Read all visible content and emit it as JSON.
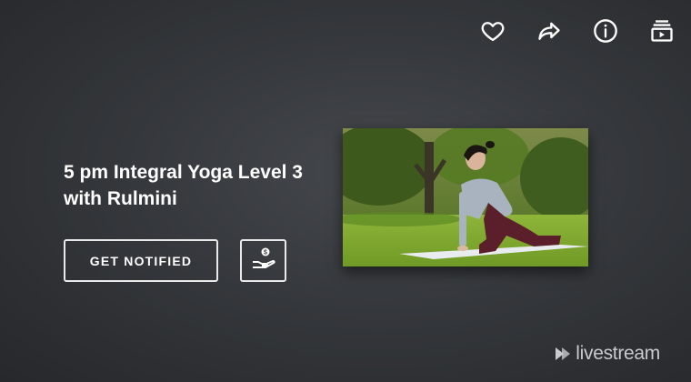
{
  "event": {
    "title": "5 pm Integral Yoga Level 3 with Rulmini"
  },
  "actions": {
    "notify_label": "GET NOTIFIED",
    "donate_icon": "donate-hand-coin-icon"
  },
  "toolbar": {
    "icons": [
      "heart-icon",
      "share-icon",
      "info-icon",
      "playlist-icon"
    ]
  },
  "thumbnail": {
    "description_icon": "video-thumbnail"
  },
  "brand": {
    "name": "livestream"
  },
  "colors": {
    "background": "#36393d",
    "text": "#ffffff",
    "button_border": "#e9e9e9",
    "brand_text": "#c9cacb"
  }
}
